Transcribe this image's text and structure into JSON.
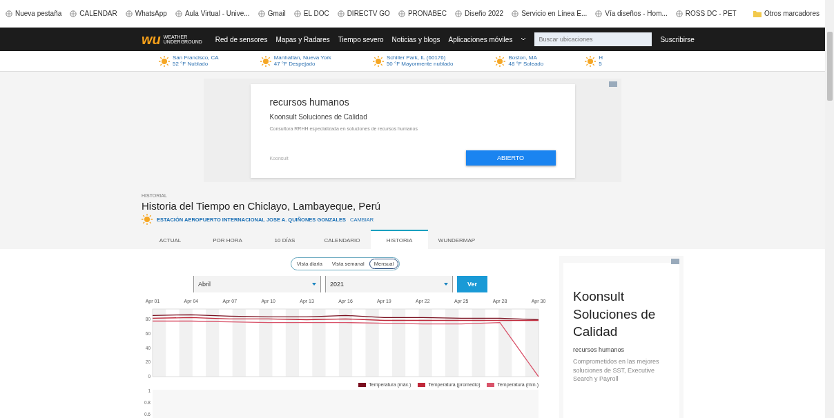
{
  "bookmarks": [
    "Nueva pestaña",
    "CALENDAR",
    "WhatsApp",
    "Aula Virtual - Unive...",
    "Gmail",
    "EL DOC",
    "DIRECTV GO",
    "PRONABEC",
    "Diseño 2022",
    "Servicio en Línea E...",
    "Vía diseños - Hom...",
    "ROSS DC - PET"
  ],
  "other_bookmarks": "Otros marcadores",
  "site_nav": {
    "logo": "wu",
    "logo_text": "WEATHER UNDERGROUND",
    "items": [
      "Red de sensores",
      "Mapas y Radares",
      "Tiempo severo",
      "Noticias y blogs",
      "Aplicaciones móviles"
    ],
    "search": {
      "placeholder": "Buscar ubicaciones"
    },
    "subscribe": "Suscribirse"
  },
  "city_strip": [
    {
      "city": "San Francisco, CA",
      "reading": "52 °F Nublado"
    },
    {
      "city": "Manhattan, Nueva York",
      "reading": "47 °F Despejado"
    },
    {
      "city": "Schiller Park, IL (60176)",
      "reading": "50 °F Mayormente nublado"
    },
    {
      "city": "Boston, MA",
      "reading": "48 °F Soleado"
    },
    {
      "city": "H",
      "reading": "5"
    }
  ],
  "top_ad": {
    "headline": "recursos humanos",
    "advertiser": "Koonsult Soluciones de Calidad",
    "description": "Consultora RRHH especializada en soluciones de recursos humanos",
    "footer": "Koonsult",
    "button": "ABIERTO"
  },
  "page_header": {
    "kicker": "HISTORIAL",
    "title": "Historia del Tiempo en Chiclayo, Lambayeque, Perú",
    "station": "ESTACIÓN AEROPUERTO INTERNACIONAL JOSE A. QUIÑONES GONZALES",
    "change": "CAMBIAR"
  },
  "tabs": [
    {
      "label": "ACTUAL",
      "selected": false
    },
    {
      "label": "POR HORA",
      "selected": false
    },
    {
      "label": "10 DÍAS",
      "selected": false
    },
    {
      "label": "CALENDARIO",
      "selected": false
    },
    {
      "label": "HISTORIA",
      "selected": true
    },
    {
      "label": "WUNDERMAP",
      "selected": false
    }
  ],
  "view_toggle": [
    {
      "label": "Vista diaria",
      "selected": false
    },
    {
      "label": "Vista semanal",
      "selected": false
    },
    {
      "label": "Mensual",
      "selected": true
    }
  ],
  "month_select": "Abril",
  "year_select": "2021",
  "view_button": "Ver",
  "temperature_chart": {
    "chart_data": {
      "type": "line",
      "x": [
        "Apr 01",
        "Apr 04",
        "Apr 07",
        "Apr 10",
        "Apr 13",
        "Apr 16",
        "Apr 19",
        "Apr 22",
        "Apr 25",
        "Apr 28",
        "Apr 30"
      ],
      "ylim": [
        0,
        95
      ],
      "yticks": [
        0,
        20,
        40,
        60,
        80
      ],
      "grid": true,
      "series": [
        {
          "name": "Temperatura (máx.)",
          "color": "#7a0f1f",
          "values": [
            86,
            87,
            85,
            84,
            84,
            86,
            83,
            83,
            82,
            82,
            80
          ]
        },
        {
          "name": "Temperatura (promedio)",
          "color": "#c0283a",
          "values": [
            82,
            83,
            81,
            81,
            80,
            81,
            79,
            79,
            79,
            79,
            79
          ]
        },
        {
          "name": "Temperatura (mín.)",
          "color": "#d9536a",
          "values": [
            78,
            78,
            77,
            76,
            76,
            76,
            75,
            74,
            74,
            76,
            0
          ]
        }
      ]
    }
  },
  "precip_chart": {
    "yticks": [
      "1",
      "0.8",
      "0.6"
    ]
  },
  "side_ad": {
    "headline": "Koonsult Soluciones de Calidad",
    "category": "recursos humanos",
    "description": "Comprometidos en las mejores soluciones de SST, Executive Search y Payroll"
  }
}
